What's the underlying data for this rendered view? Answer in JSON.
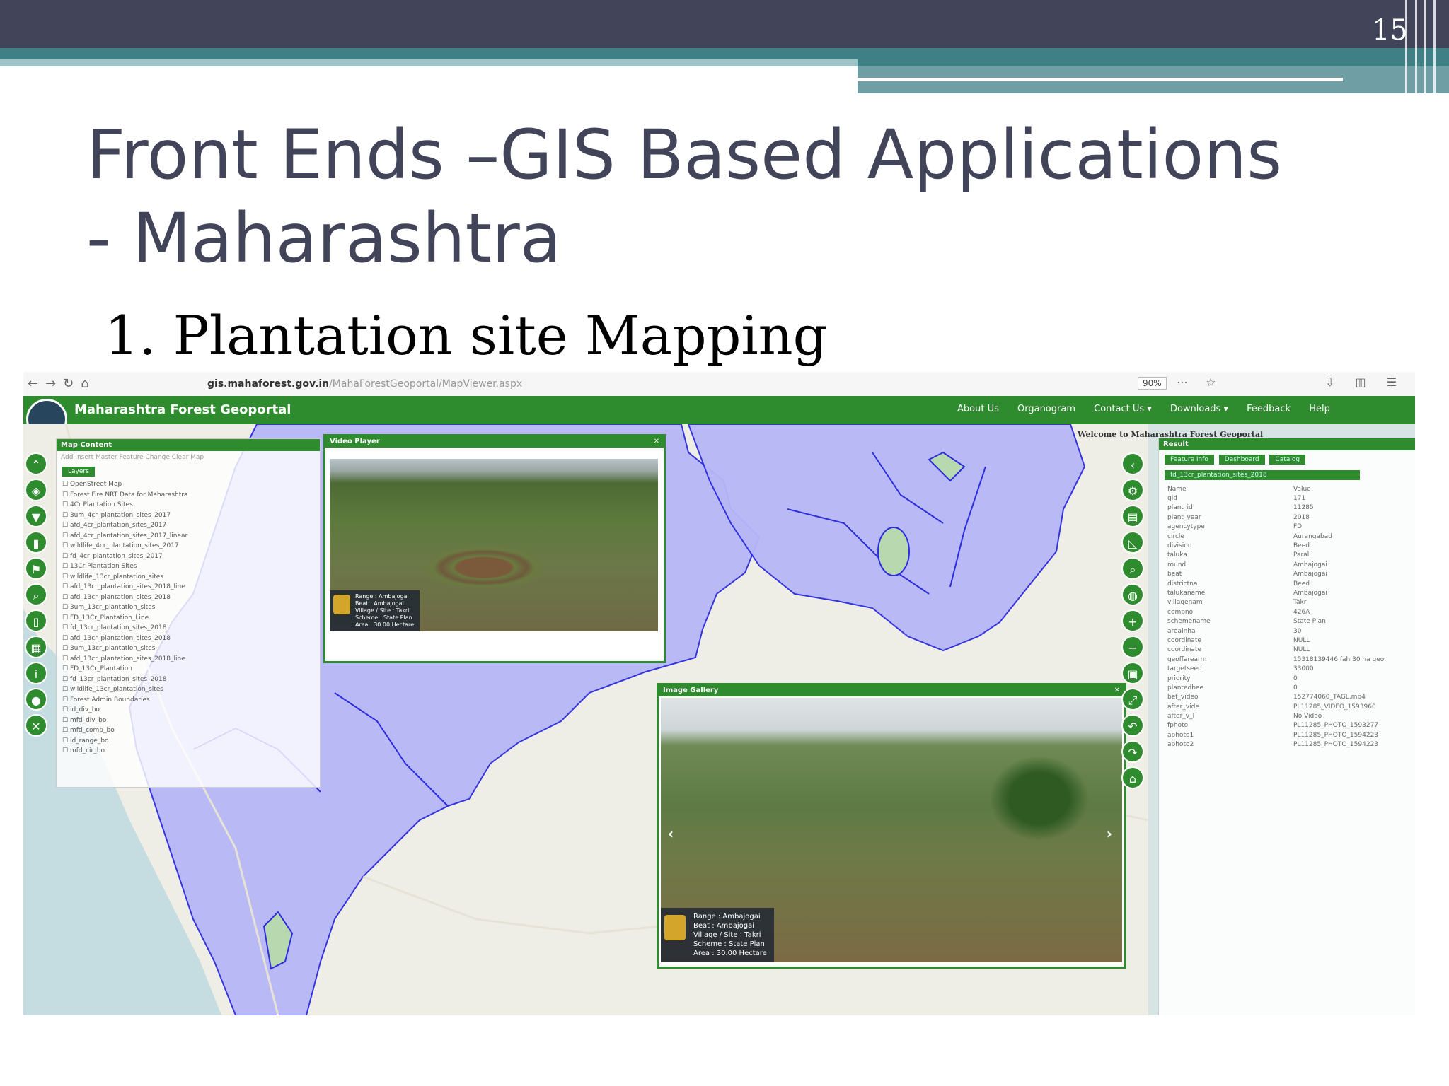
{
  "slide": {
    "number": "15",
    "title": "Front Ends –GIS Based Applications - Maharashtra",
    "subtitle": "1. Plantation site Mapping"
  },
  "browser": {
    "url_domain": "gis.mahaforest.gov.in",
    "url_path": "/MahaForestGeoportal/MapViewer.aspx",
    "zoom": "90%"
  },
  "app": {
    "title": "Maharashtra Forest Geoportal",
    "menu": [
      "About Us",
      "Organogram",
      "Contact Us ▾",
      "Downloads ▾",
      "Feedback",
      "Help"
    ],
    "welcome": "Welcome to Maharashtra Forest Geoportal"
  },
  "map_content": {
    "header": "Map Content",
    "tools": "Add   Insert   Master   Feature Change   Clear Map",
    "layers_tab": "Layers",
    "tree": [
      "OpenStreet Map",
      "Forest Fire NRT Data for Maharashtra",
      "4Cr Plantation Sites",
      "3um_4cr_plantation_sites_2017",
      "afd_4cr_plantation_sites_2017",
      "afd_4cr_plantation_sites_2017_linear",
      "wildlife_4cr_plantation_sites_2017",
      "fd_4cr_plantation_sites_2017",
      "13Cr Plantation Sites",
      "wildlife_13cr_plantation_sites",
      "afd_13cr_plantation_sites_2018_line",
      "afd_13cr_plantation_sites_2018",
      "3um_13cr_plantation_sites",
      "FD_13Cr_Plantation_Line",
      "fd_13cr_plantation_sites_2018",
      "afd_13cr_plantation_sites_2018",
      "3um_13cr_plantation_sites",
      "afd_13cr_plantation_sites_2018_line",
      "FD_13Cr_Plantation",
      "fd_13cr_plantation_sites_2018",
      "wildlife_13cr_plantation_sites",
      "Forest Admin Boundaries",
      "id_div_bo",
      "mfd_div_bo",
      "mfd_comp_bo",
      "id_range_bo",
      "mfd_cir_bo"
    ]
  },
  "video_panel": {
    "title": "Video Player",
    "info": [
      "Range : Ambajogai",
      "Beat : Ambajogai",
      "Village / Site : Takri",
      "Scheme : State Plan",
      "Area : 30.00 Hectare"
    ]
  },
  "gallery_panel": {
    "title": "Image Gallery",
    "info": [
      "Range : Ambajogai",
      "Beat : Ambajogai",
      "Village / Site : Takri",
      "Scheme : State Plan",
      "Area : 30.00 Hectare"
    ]
  },
  "result_panel": {
    "header": "Result",
    "tabs": [
      "Feature Info",
      "Dashboard",
      "Catalog"
    ],
    "layer": "fd_13cr_plantation_sites_2018",
    "rows": [
      [
        "Name",
        "Value"
      ],
      [
        "gid",
        "171"
      ],
      [
        "plant_id",
        "11285"
      ],
      [
        "plant_year",
        "2018"
      ],
      [
        "agencytype",
        "FD"
      ],
      [
        "circle",
        "Aurangabad"
      ],
      [
        "division",
        "Beed"
      ],
      [
        "taluka",
        "Parali"
      ],
      [
        "round",
        "Ambajogai"
      ],
      [
        "beat",
        "Ambajogai"
      ],
      [
        "districtna",
        "Beed"
      ],
      [
        "talukaname",
        "Ambajogai"
      ],
      [
        "villagenam",
        "Takri"
      ],
      [
        "compno",
        "426A"
      ],
      [
        "schemename",
        "State Plan"
      ],
      [
        "areainha",
        "30"
      ],
      [
        "coordinate",
        "NULL"
      ],
      [
        "coordinate",
        "NULL"
      ],
      [
        "geoffarearm",
        "15318139446 fah 30 ha geo"
      ],
      [
        "targetseed",
        "33000"
      ],
      [
        "priority",
        "0"
      ],
      [
        "plantedbee",
        "0"
      ],
      [
        "bef_video",
        "152774060_TAGL.mp4"
      ],
      [
        "after_vide",
        "PL11285_VIDEO_1593960"
      ],
      [
        "after_v_l",
        "No Video"
      ],
      [
        "fphoto",
        "PL11285_PHOTO_1593277"
      ],
      [
        "aphoto1",
        "PL11285_PHOTO_1594223"
      ],
      [
        "aphoto2",
        "PL11285_PHOTO_1594223"
      ]
    ]
  },
  "colors": {
    "slide_band": "#42445a",
    "slide_accent": "#3f7f86",
    "app_green": "#2e8b2e",
    "polygon_fill": "#b7b7f7",
    "polygon_stroke": "#2c2ce0"
  },
  "icons": {
    "left_toolbar": [
      "chevron-up-icon",
      "layers-icon",
      "filter-icon",
      "chart-icon",
      "flag-icon",
      "search-icon",
      "trash-icon",
      "grid-icon",
      "info-icon",
      "location-icon",
      "tools-icon"
    ],
    "right_toolbar": [
      "chevron-left-icon",
      "gear-icon",
      "map-icon",
      "measure-icon",
      "identify-icon",
      "globe-icon",
      "zoom-in-icon",
      "zoom-out-icon",
      "extent-icon",
      "fullscreen-icon",
      "undo-icon",
      "redo-icon",
      "home-icon"
    ]
  }
}
